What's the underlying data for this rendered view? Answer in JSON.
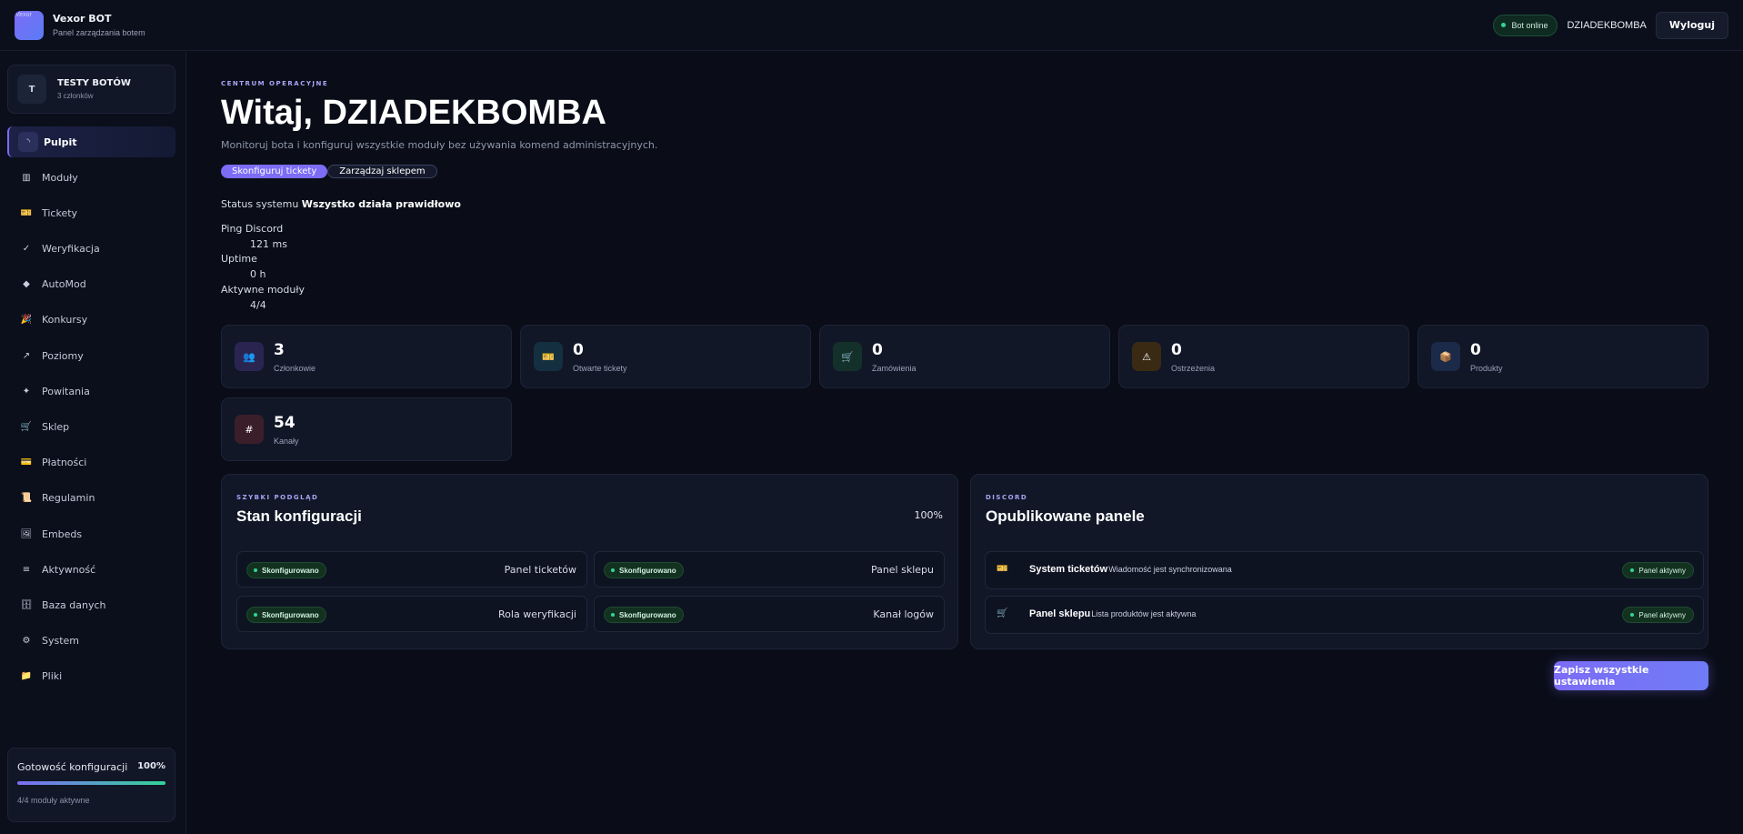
{
  "brand": {
    "logo_text": "Vexor",
    "name": "Vexor BOT",
    "subtitle": "Panel zarządzania botem"
  },
  "header": {
    "status": "Bot online",
    "username": "DZIADEKBOMBA",
    "logout_label": "Wyloguj"
  },
  "server": {
    "initial": "T",
    "name": "TESTY BOTÓW",
    "members": "3 członków"
  },
  "nav": [
    {
      "label": "Pulpit",
      "icon": "◝",
      "active": true
    },
    {
      "label": "Moduły",
      "icon": "▥"
    },
    {
      "label": "Tickety",
      "icon": "🎫"
    },
    {
      "label": "Weryfikacja",
      "icon": "✓"
    },
    {
      "label": "AutoMod",
      "icon": "◆"
    },
    {
      "label": "Konkursy",
      "icon": "🎉"
    },
    {
      "label": "Poziomy",
      "icon": "↗"
    },
    {
      "label": "Powitania",
      "icon": "✦"
    },
    {
      "label": "Sklep",
      "icon": "🛒"
    },
    {
      "label": "Płatności",
      "icon": "💳"
    },
    {
      "label": "Regulamin",
      "icon": "📜"
    },
    {
      "label": "Embeds",
      "icon": "🖼"
    },
    {
      "label": "Aktywność",
      "icon": "≡"
    },
    {
      "label": "Baza danych",
      "icon": "🗄"
    },
    {
      "label": "System",
      "icon": "⚙"
    },
    {
      "label": "Pliki",
      "icon": "📁"
    }
  ],
  "readiness": {
    "label": "Gotowość konfiguracji",
    "percent": "100%",
    "value": 1.0,
    "sub": "4/4 moduły aktywne"
  },
  "hero": {
    "eyebrow": "CENTRUM OPERACYJNE",
    "title": "Witaj, DZIADEKBOMBA",
    "subtitle": "Monitoruj bota i konfiguruj wszystkie moduły bez używania komend administracyjnych.",
    "btn_primary": "Skonfiguruj tickety",
    "btn_secondary": "Zarządzaj sklepem"
  },
  "system": {
    "status_label": "Status systemu",
    "status_value": "Wszystko działa prawidłowo",
    "stats": [
      {
        "label": "Ping Discord",
        "value": "121 ms"
      },
      {
        "label": "Uptime",
        "value": "0 h"
      },
      {
        "label": "Aktywne moduły",
        "value": "4/4"
      }
    ]
  },
  "cards": [
    {
      "value": "3",
      "label": "Członkowie",
      "icon": "👥",
      "color": "#2a2550"
    },
    {
      "value": "0",
      "label": "Otwarte tickety",
      "icon": "🎫",
      "color": "#143040"
    },
    {
      "value": "0",
      "label": "Zamówienia",
      "icon": "🛒",
      "color": "#14302a"
    },
    {
      "value": "0",
      "label": "Ostrzeżenia",
      "icon": "⚠",
      "color": "#3a2a14"
    },
    {
      "value": "0",
      "label": "Produkty",
      "icon": "📦",
      "color": "#1a2a48"
    },
    {
      "value": "54",
      "label": "Kanały",
      "icon": "#",
      "color": "#3a1f2a"
    }
  ],
  "config": {
    "eyebrow": "SZYBKI PODGLĄD",
    "title": "Stan konfiguracji",
    "percent": "100%",
    "badge": "Skonfigurowano",
    "items": [
      "Panel ticketów",
      "Panel sklepu",
      "Rola weryfikacji",
      "Kanał logów"
    ]
  },
  "published": {
    "eyebrow": "DISCORD",
    "title": "Opublikowane panele",
    "badge": "Panel aktywny",
    "items": [
      {
        "icon": "🎫",
        "title": "System ticketów",
        "desc": "Wiadomość jest synchronizowana"
      },
      {
        "icon": "🛒",
        "title": "Panel sklepu",
        "desc": "Lista produktów jest aktywna"
      }
    ]
  },
  "save_label": "Zapisz wszystkie ustawienia"
}
